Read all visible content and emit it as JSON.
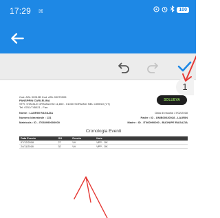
{
  "status_bar": {
    "time": "17:29",
    "small_indicator": "ℍ",
    "icons": [
      "location-icon",
      "alarm-icon",
      "bluetooth-icon"
    ],
    "battery": "100"
  },
  "toolbar": {
    "undo_icon": "undo-icon",
    "redo_icon": "redo-icon",
    "confirm_icon": "check-icon",
    "page_number": "1"
  },
  "document": {
    "header_lines": [
      "Cod. ASL 00912B    Cod. ASL 00070905",
      "PANSPRIN CARLELINA",
      "STR. STATALE ORTANA KM 11,800 - 01030 SORIANO NEL CIMINO (VT)",
      "Tel: 0761/745021 - Fax:"
    ],
    "logo_text": "SOLUEVA",
    "name_line": "Nome : LAURIN RAGAZIA",
    "date_line": "Data di nascita 17/02/2018",
    "number_line": "Numero bimestrale : 131",
    "father_line": "Padre : ID - UNIB00020028 - LAURIN",
    "matricola_line": "Matricola : ID - IT060990000000",
    "mother_line": "Madre : ID - IT060990000 - BUONIPE RAGAZIA",
    "report_title": "Cronologia Eventi",
    "columns": [
      "Data Evento",
      "GG",
      "Evento",
      "Note"
    ],
    "rows": [
      [
        "07/12/2018",
        "27",
        "VV",
        "VPP - OK"
      ],
      [
        "24/11/2018",
        "32",
        "VV",
        "VPP - OK"
      ]
    ]
  },
  "colors": {
    "primary": "#1e88e5",
    "toolbar_bg": "#ececec",
    "annotation": "#e53935"
  }
}
